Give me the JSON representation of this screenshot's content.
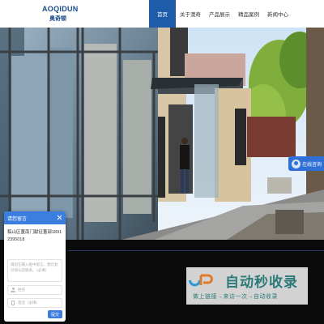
{
  "header": {
    "logo_en": "AOQIDUN",
    "logo_cn": "奥奇顿",
    "nav": [
      {
        "label": "首页",
        "active": true
      },
      {
        "label": "关于澳奇",
        "active": false
      },
      {
        "label": "产品展示",
        "active": false
      },
      {
        "label": "精品案例",
        "active": false
      },
      {
        "label": "新闻中心",
        "active": false
      }
    ]
  },
  "online_chat": {
    "label": "在线咨询"
  },
  "message_panel": {
    "title": "请您留言",
    "intro": "稿山区董南门献征董部18912395018",
    "textarea_placeholder": "请您在输入框中留言，我们会尽快与您联系。（必填）",
    "name_placeholder": "姓名",
    "phone_placeholder": "电话（必填）",
    "submit_label": "提交"
  },
  "watermark": {
    "title": "自动秒收录",
    "subtitle": "做上链接→来访一次→自动收录"
  },
  "colors": {
    "primary": "#1e5ba8",
    "chat": "#2f6fd6",
    "panel_head": "#3b7ee0",
    "watermark": "#2a7a7a"
  }
}
